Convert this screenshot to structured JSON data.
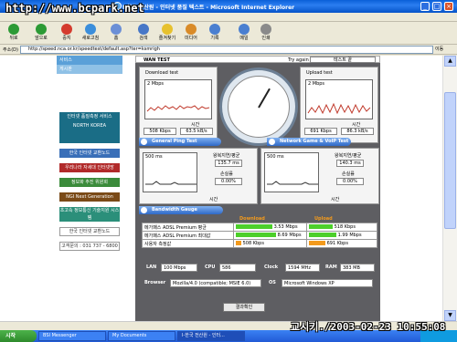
{
  "window": {
    "title": "I-한국 전산원 - 인터넷 품질 텍스트 - Microsoft Internet Explorer",
    "watermark": "http://www.bcpark.net"
  },
  "toolbar": {
    "items": [
      "뒤로",
      "앞으로",
      "중지",
      "새로고침",
      "홈",
      "검색",
      "즐겨찾기",
      "미디어",
      "기록",
      "메일",
      "인쇄"
    ]
  },
  "address": {
    "label": "주소(D)",
    "url": "http://speed.nca.or.kr/speedtest/default.asp?ter=ksmrigh",
    "go": "이동"
  },
  "sidebar": {
    "tab1": "서비스",
    "tab2": "게시판",
    "banners": [
      "인터넷 품질측정 서비스 NORTH KOREA",
      "한국 인터넷 교환노드",
      "우리나라 자세대 인터넷망",
      "정보화 추진 위원회",
      "NGI Next Generation",
      "초고속 정보통신 기술지원 시스템",
      "한국 인터넷 교환노드",
      "고객문의 : 031 737 - 6800"
    ]
  },
  "main": {
    "header": {
      "label": "WAN TEST",
      "by": "Try again",
      "name": "테스트 끝"
    },
    "download": {
      "title": "Download test",
      "unit": "2 Mbps",
      "axis": "시간",
      "v1": "508 Kbps",
      "v2": "63.5 kB/s"
    },
    "upload": {
      "title": "Upload test",
      "unit": "2 Mbps",
      "axis": "시간",
      "v1": "691 Kbps",
      "v2": "86.3 kB/s"
    },
    "ping": {
      "title": "General Ping Test",
      "unit": "500 ms",
      "axis": "시간",
      "avg_label": "왕복지연/평균",
      "avg": "135.7 ms",
      "loss_label": "손실률",
      "loss": "0.00%"
    },
    "game": {
      "title": "Network Game & VoIP Test",
      "unit": "500 ms",
      "axis": "시간",
      "avg_label": "왕복지연/평균",
      "avg": "140.3 ms",
      "loss_label": "손실률",
      "loss": "0.00%"
    },
    "gauge": {
      "title": "Bandwidth Gauge",
      "dl_header": "Download",
      "ul_header": "Upload",
      "rows": [
        {
          "label": "메가패스 ADSL Premium 평균",
          "dl": "3.53 Mbps",
          "ul": "518 Kbps"
        },
        {
          "label": "메가패스 ADSL Premium 최대값",
          "dl": "8.69 Mbps",
          "ul": "1.99 Mbps"
        },
        {
          "label": "사용자 측정값",
          "dl": "508 Kbps",
          "ul": "691 Kbps"
        }
      ]
    },
    "sys": {
      "lan_label": "LAN",
      "lan": "100 Mbps",
      "cpu_label": "CPU",
      "cpu": "586",
      "clock_label": "Clock",
      "clock": "1594 MHz",
      "ram_label": "RAM",
      "ram": "383 MB",
      "browser_label": "Browser",
      "browser": "Mozilla/4.0 (compatible; MSIE 6.0)",
      "os_label": "OS",
      "os": "Microsoft Windows XP"
    },
    "result_button": "결과확인"
  },
  "taskbar": {
    "start": "시작",
    "tasks": [
      "BSI Messenger",
      "My Documents",
      "I-한국 전산원 - 인터..."
    ]
  },
  "stamp": "교시키./2003-02-23 10:55:08",
  "colors": {
    "accent": "#2f69c8",
    "green": "#4ccf2a",
    "upload_orange": "#f39a1c"
  }
}
